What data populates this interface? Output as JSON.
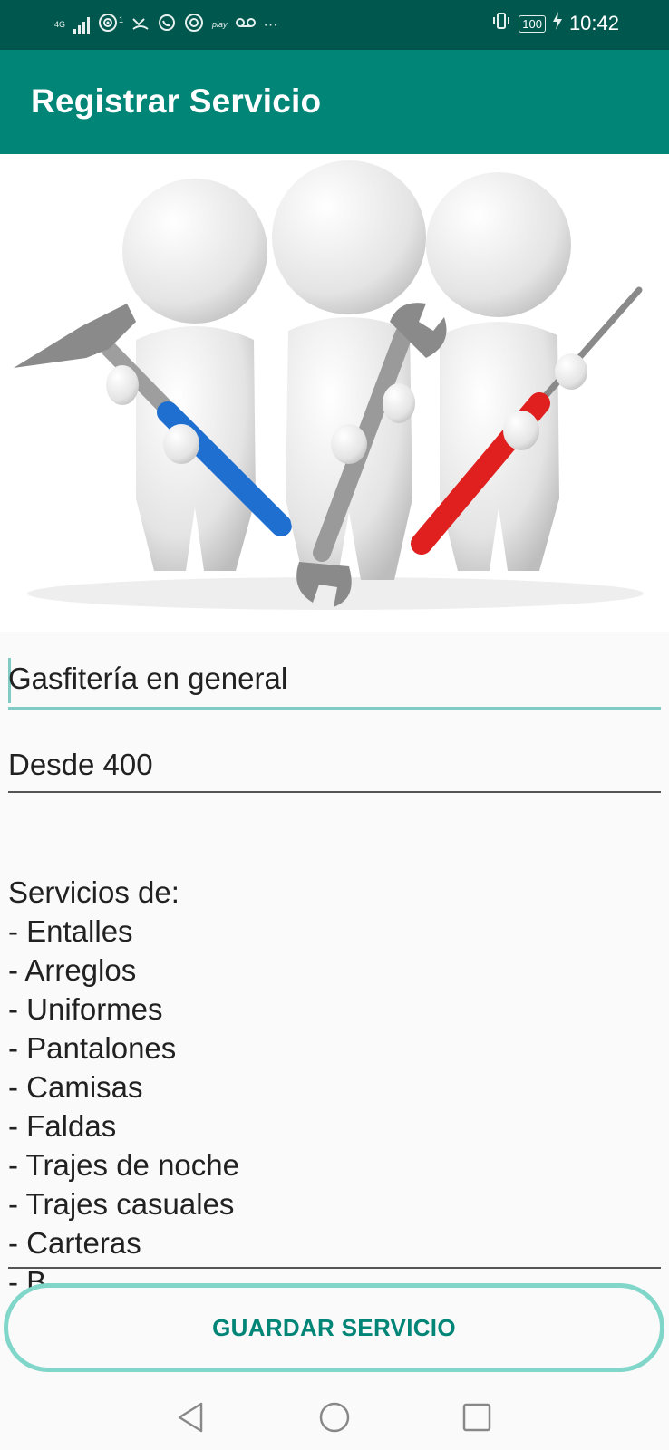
{
  "status_bar": {
    "network": "4G",
    "notification_count": "1",
    "notification_label": "play",
    "more": "···",
    "battery": "100",
    "time": "10:42"
  },
  "app_bar": {
    "title": "Registrar Servicio"
  },
  "illustration": {
    "icon": "three-workers-with-tools"
  },
  "form": {
    "service_name": {
      "value": "Gasfitería en general"
    },
    "price": {
      "value": "Desde 400"
    },
    "description": {
      "value": "Servicios de:\n- Entalles\n- Arreglos\n- Uniformes\n- Pantalones\n- Camisas\n- Faldas\n- Trajes de noche\n- Trajes casuales\n- Carteras\n- B"
    }
  },
  "actions": {
    "save_label": "GUARDAR SERVICIO"
  },
  "colors": {
    "status_bar": "#00574d",
    "app_bar": "#008577",
    "accent": "#80cbc4",
    "button_text": "#008577"
  },
  "nav": {
    "back_icon": "back-triangle",
    "home_icon": "home-circle",
    "recents_icon": "recents-square"
  }
}
